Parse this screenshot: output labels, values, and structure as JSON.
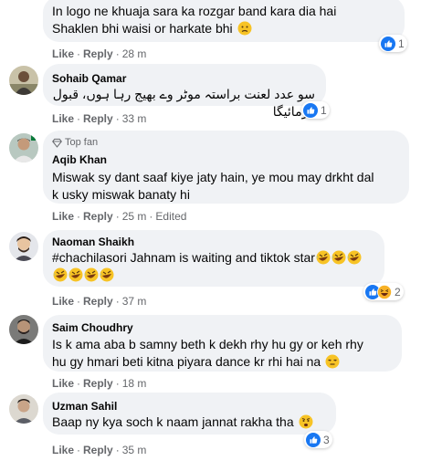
{
  "comments": [
    {
      "author": "",
      "lines": [
        "In logo ne khuaja sara ka rozgar band kara dia hai",
        "Shaklen bhi waisi or harkate bhi"
      ],
      "emoji": "sad-face",
      "like_label": "Like",
      "reply_label": "Reply",
      "time": "28 m",
      "reactions": [
        "like"
      ],
      "reaction_count": "1"
    },
    {
      "author": "Sohaib Qamar",
      "lines": [
        "سو عدد لعنت براستہ موٹر وے بھیج رہا ہوں، قبول فرمائیگا"
      ],
      "like_label": "Like",
      "reply_label": "Reply",
      "time": "33 m",
      "reactions": [
        "like"
      ],
      "reaction_count": "1"
    },
    {
      "author": "Aqib Khan",
      "badge": "Top fan",
      "lines": [
        "Miswak sy dant saaf kiye jaty hain, ye mou may drkht dal",
        "k usky miswak banaty hi"
      ],
      "like_label": "Like",
      "reply_label": "Reply",
      "time": "25 m",
      "edited": "Edited"
    },
    {
      "author": "Naoman Shaikh",
      "lines": [
        "#chachilasori Jahnam is waiting and tiktok star"
      ],
      "emoji": "rofl",
      "like_label": "Like",
      "reply_label": "Reply",
      "time": "37 m",
      "reactions": [
        "like",
        "haha"
      ],
      "reaction_count": "2"
    },
    {
      "author": "Saim Choudhry",
      "lines": [
        "Is k ama aba b samny beth k dekh rhy hu gy or keh rhy",
        "hu gy hmari beti kitna piyara dance kr rhi hai na"
      ],
      "emoji": "unamused",
      "like_label": "Like",
      "reply_label": "Reply",
      "time": "18 m"
    },
    {
      "author": "Uzman Sahil",
      "lines": [
        "Baap ny kya soch k naam jannat rakha tha"
      ],
      "emoji": "worried",
      "like_label": "Like",
      "reply_label": "Reply",
      "time": "35 m",
      "reactions": [
        "like"
      ],
      "reaction_count": "3"
    }
  ],
  "colors": {
    "bubble": "#f0f2f5",
    "meta_text": "#65676b",
    "like_blue": "#1877f2",
    "haha_yellow": "#f7b125"
  }
}
